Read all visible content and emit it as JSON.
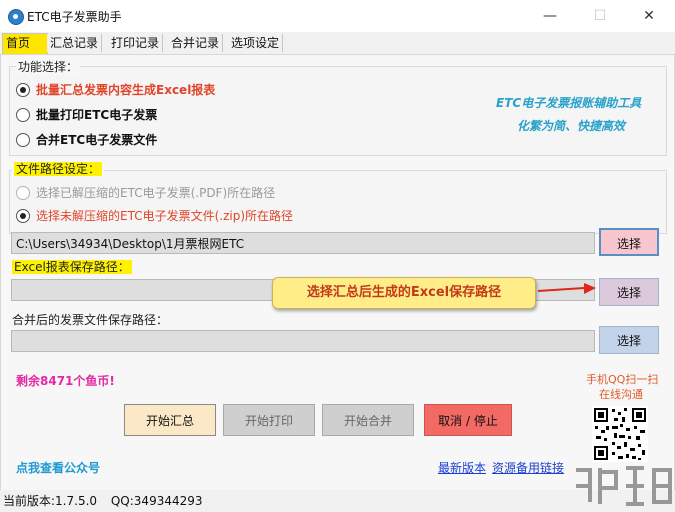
{
  "window": {
    "title": "ETC电子发票助手",
    "controls": {
      "minimize": "—",
      "maximize": "☐",
      "close": "✕"
    }
  },
  "tabs": [
    {
      "label": "首页",
      "active": true
    },
    {
      "label": "汇总记录",
      "active": false
    },
    {
      "label": "打印记录",
      "active": false
    },
    {
      "label": "合并记录",
      "active": false
    },
    {
      "label": "选项设定",
      "active": false
    }
  ],
  "function_group": {
    "legend": "功能选择：",
    "options": [
      {
        "label": "批量汇总发票内容生成Excel报表",
        "checked": true
      },
      {
        "label": "批量打印ETC电子发票",
        "checked": false
      },
      {
        "label": "合并ETC电子发票文件",
        "checked": false
      }
    ],
    "tool_title": "ETC电子发票报账辅助工具",
    "tool_slogan": "化繁为简、快捷高效"
  },
  "path_group": {
    "legend": "文件路径设定：",
    "options": [
      {
        "label": "选择已解压缩的ETC电子发票(.PDF)所在路径",
        "checked": false,
        "disabled": true
      },
      {
        "label": "选择未解压缩的ETC电子发票文件(.zip)所在路径",
        "checked": true,
        "disabled": false
      }
    ],
    "source_path": "C:\\Users\\34934\\Desktop\\1月票根网ETC",
    "select_label": "选择"
  },
  "excel_path": {
    "label": "Excel报表保存路径：",
    "value": "",
    "select_label": "选择",
    "callout": "选择汇总后生成的Excel保存路径"
  },
  "merge_path": {
    "label": "合并后的发票文件保存路径：",
    "value": "",
    "select_label": "选择"
  },
  "coins": "剩余8471个鱼币!",
  "qq_scan": {
    "line1": "手机QQ扫一扫",
    "line2": "在线沟通"
  },
  "actions": {
    "start_summary": "开始汇总",
    "start_print": "开始打印",
    "start_merge": "开始合并",
    "cancel_stop": "取消 / 停止"
  },
  "links": {
    "public_account": "点我查看公众号",
    "new_version": "最新版本",
    "backup_link": "资源备用链接"
  },
  "status": {
    "version": "当前版本:1.7.5.0",
    "qq": "QQ:349344293"
  },
  "colors": {
    "highlight": "#fff200",
    "checked_option": "#e0452a",
    "tool_text": "#2aa2c9",
    "coins_text": "#e32aa3",
    "cancel_button": "#f26a63",
    "start_button": "#fbe8c6"
  }
}
